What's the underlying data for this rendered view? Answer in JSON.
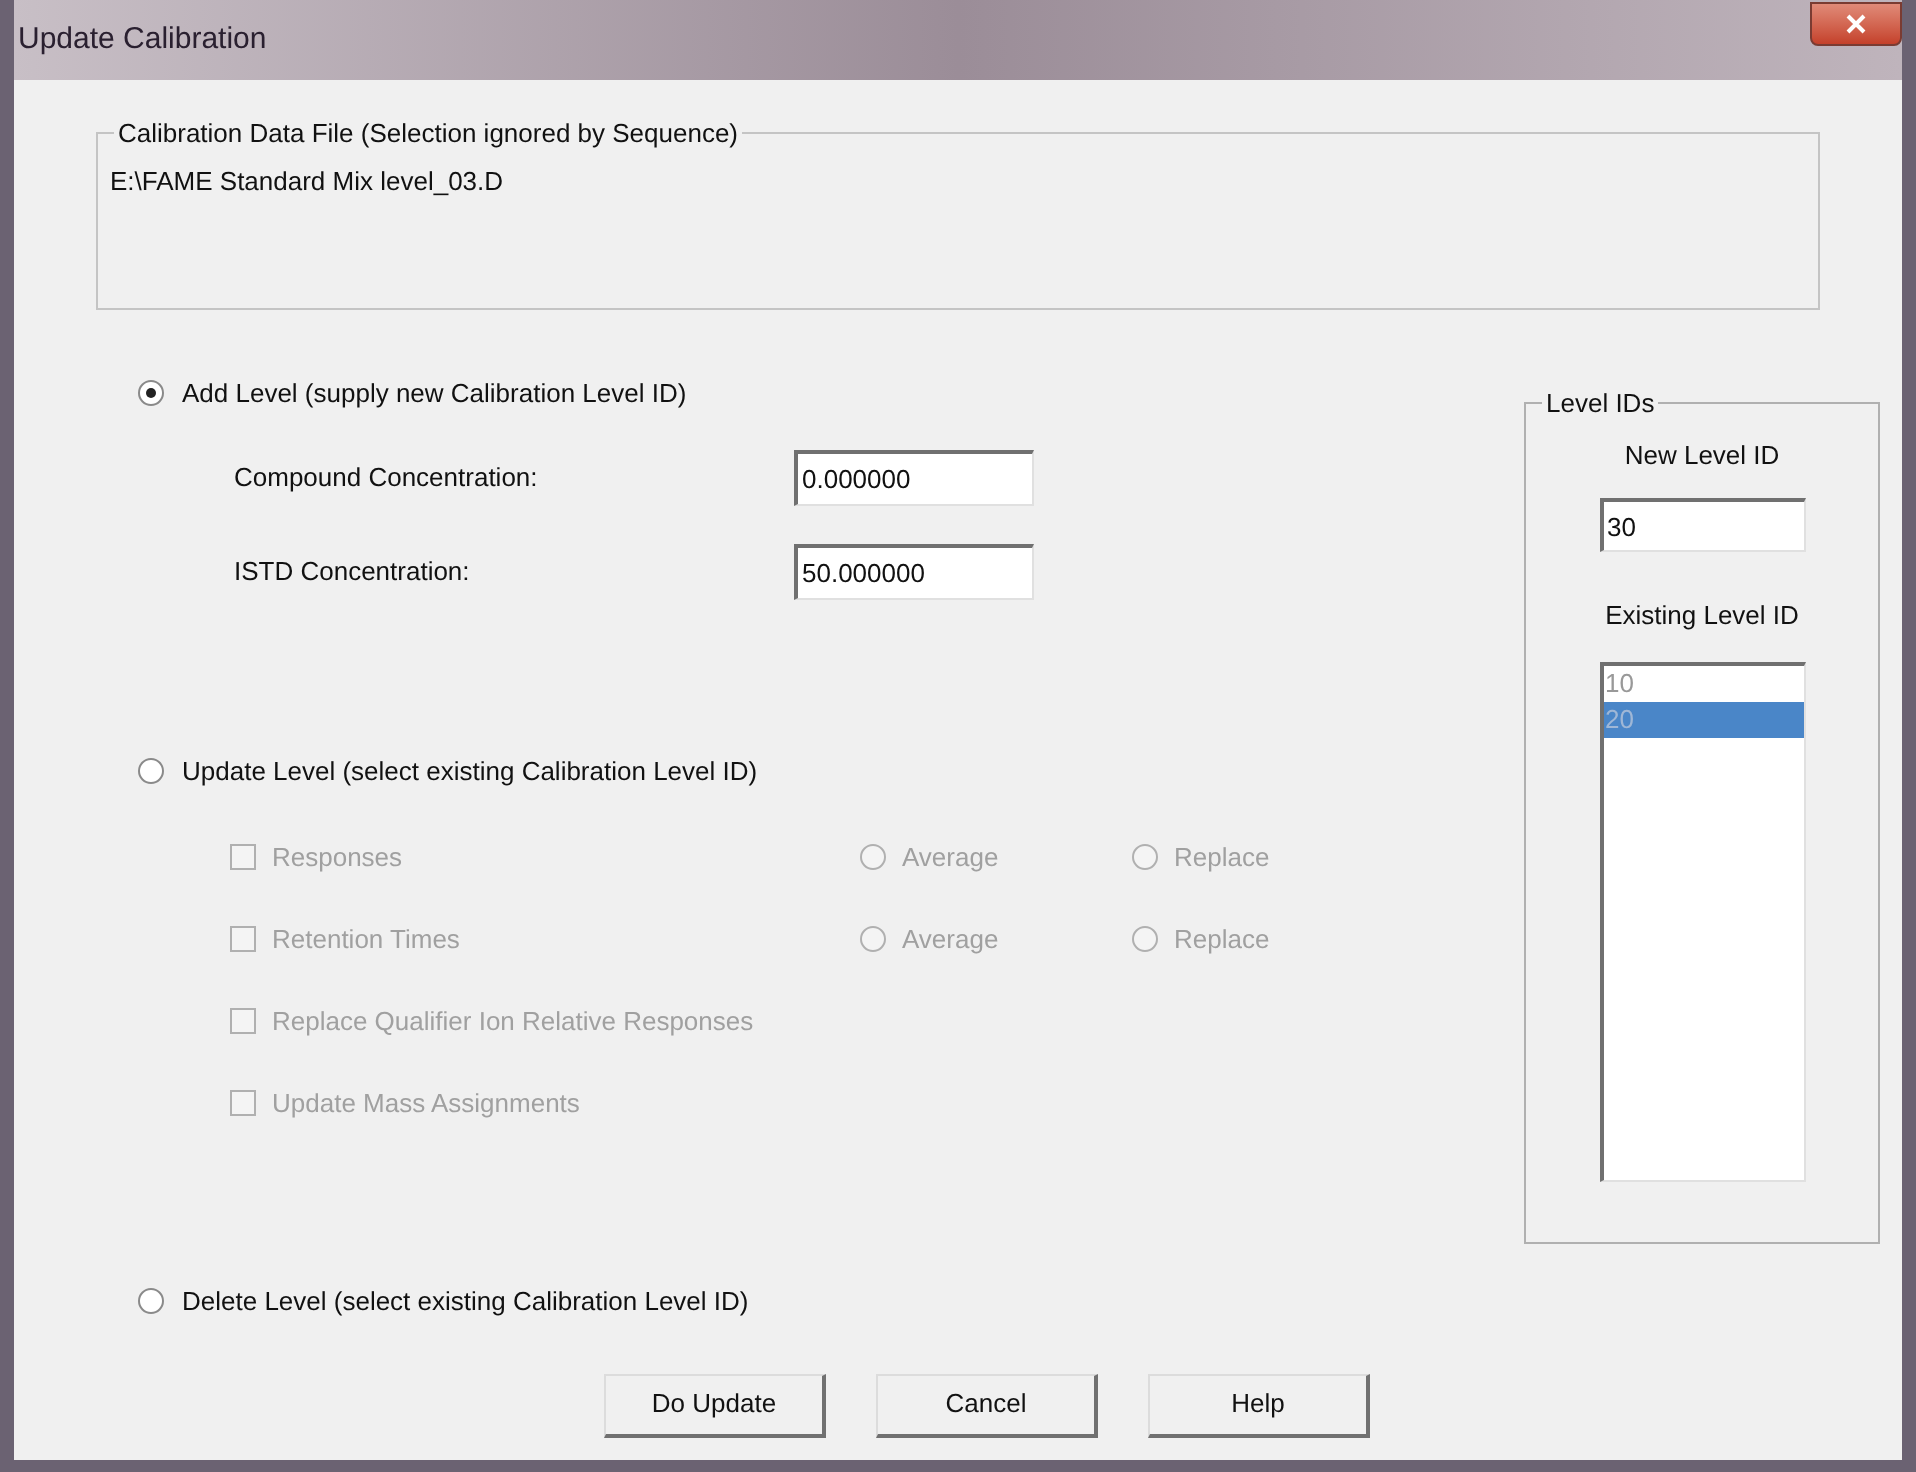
{
  "window": {
    "title": "Update Calibration"
  },
  "data_file": {
    "legend": "Calibration Data File (Selection ignored by Sequence)",
    "path": "E:\\FAME Standard Mix level_03.D"
  },
  "add_level": {
    "label": "Add Level (supply new Calibration Level ID)",
    "selected": true,
    "fields": [
      {
        "label": "Compound Concentration:",
        "value": "0.000000"
      },
      {
        "label": "ISTD Concentration:",
        "value": "50.000000"
      }
    ]
  },
  "update_level": {
    "label": "Update Level (select existing Calibration Level ID)",
    "selected": false,
    "options": [
      {
        "label": "Responses",
        "checked": false,
        "disabled": true,
        "choices": [
          {
            "label": "Average",
            "selected": false
          },
          {
            "label": "Replace",
            "selected": false
          }
        ]
      },
      {
        "label": "Retention Times",
        "checked": false,
        "disabled": true,
        "choices": [
          {
            "label": "Average",
            "selected": false
          },
          {
            "label": "Replace",
            "selected": false
          }
        ]
      },
      {
        "label": "Replace Qualifier Ion Relative Responses",
        "checked": false,
        "disabled": true
      },
      {
        "label": "Update Mass Assignments",
        "checked": false,
        "disabled": true
      }
    ]
  },
  "delete_level": {
    "label": "Delete Level (select existing Calibration Level ID)",
    "selected": false
  },
  "level_ids": {
    "legend": "Level IDs",
    "new_label": "New Level ID",
    "new_value": "30",
    "existing_label": "Existing Level ID",
    "existing": [
      {
        "label": "10",
        "selected": false
      },
      {
        "label": "20",
        "selected": true
      }
    ]
  },
  "buttons": [
    "Do Update",
    "Cancel",
    "Help"
  ]
}
